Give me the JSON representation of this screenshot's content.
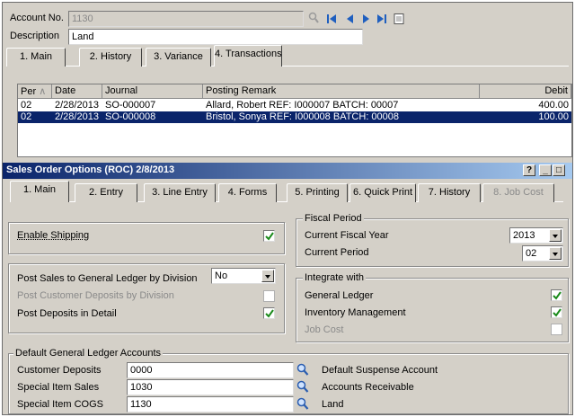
{
  "account": {
    "account_no_label": "Account No.",
    "account_no_value": "1130",
    "description_label": "Description",
    "description_value": "Land"
  },
  "account_tabs": [
    {
      "label": "1. Main"
    },
    {
      "label": "2. History"
    },
    {
      "label": "3. Variance"
    },
    {
      "label": "4. Transactions"
    }
  ],
  "transactions": {
    "columns": [
      "Per",
      "Date",
      "Journal",
      "Posting Remark",
      "Debit"
    ],
    "rows": [
      {
        "per": "02",
        "date": "2/28/2013",
        "journal": "SO-000007",
        "remark": "Allard, Robert REF: I000007 BATCH: 00007",
        "debit": "400.00"
      },
      {
        "per": "02",
        "date": "2/28/2013",
        "journal": "SO-000008",
        "remark": "Bristol, Sonya REF: I000008 BATCH: 00008",
        "debit": "100.00"
      }
    ]
  },
  "dialog": {
    "title": "Sales Order Options (ROC) 2/8/2013",
    "help_btn": "?",
    "min_btn": "_",
    "max_btn": "□",
    "close_btn": "×"
  },
  "dialog_tabs": [
    {
      "label": "1. Main"
    },
    {
      "label": "2. Entry"
    },
    {
      "label": "3. Line Entry"
    },
    {
      "label": "4. Forms"
    },
    {
      "label": "5. Printing"
    },
    {
      "label": "6. Quick Print"
    },
    {
      "label": "7. History"
    },
    {
      "label": "8. Job Cost"
    }
  ],
  "options": {
    "enable_shipping_label": "Enable Shipping",
    "enable_shipping_checked": true,
    "post_sales_label": "Post Sales to General Ledger by Division",
    "post_sales_value": "No",
    "post_deposits_division_label": "Post Customer Deposits by Division",
    "post_deposits_detail_label": "Post Deposits in Detail"
  },
  "fiscal": {
    "group_title": "Fiscal Period",
    "year_label": "Current Fiscal Year",
    "year_value": "2013",
    "period_label": "Current Period",
    "period_value": "02"
  },
  "integrate": {
    "group_title": "Integrate with",
    "gl_label": "General Ledger",
    "im_label": "Inventory Management",
    "jc_label": "Job Cost"
  },
  "gl_accounts": {
    "group_title": "Default General Ledger Accounts",
    "rows": [
      {
        "label": "Customer Deposits",
        "value": "0000",
        "desc": "Default Suspense Account"
      },
      {
        "label": "Special Item Sales",
        "value": "1030",
        "desc": "Accounts Receivable"
      },
      {
        "label": "Special Item COGS",
        "value": "1130",
        "desc": "Land"
      }
    ]
  },
  "colors": {
    "window_bg": "#d4d0c8",
    "selection": "#0a246a",
    "check": "#1a8a1a"
  }
}
